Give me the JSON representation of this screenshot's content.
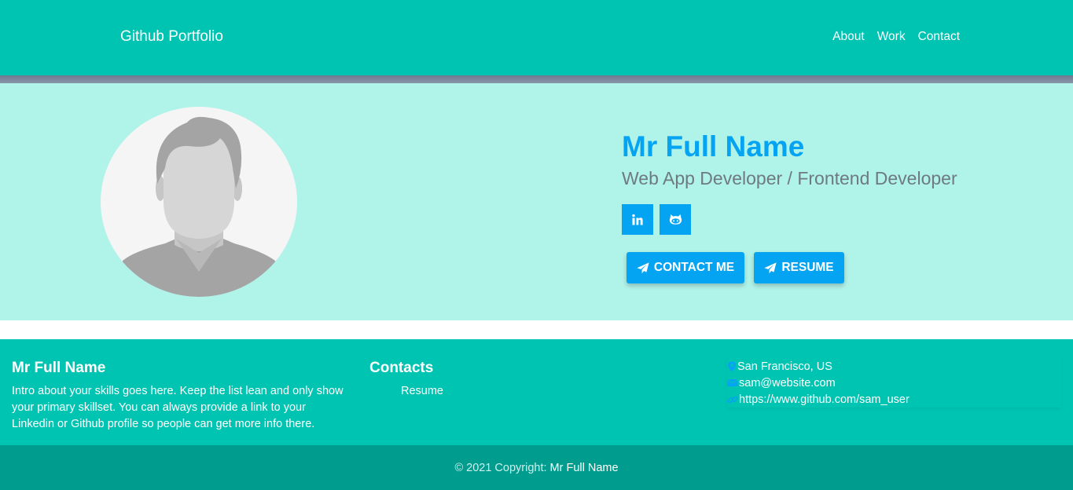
{
  "navbar": {
    "brand": "Github Portfolio",
    "links": [
      "About",
      "Work",
      "Contact"
    ]
  },
  "hero": {
    "name": "Mr Full Name",
    "role": "Web App Developer / Frontend Developer",
    "social_icons": [
      "linkedin-icon",
      "github-icon"
    ],
    "buttons": {
      "contact_label": "CONTACT ME",
      "resume_label": "RESUME",
      "icon": "paper-plane-icon"
    }
  },
  "footer": {
    "about_title": "Mr Full Name",
    "about_text": "Intro about your skills goes here. Keep the list lean and only show your primary skillset. You can always provide a link to your Linkedin or Github profile so people can get more info there.",
    "contacts_title": "Contacts",
    "contacts_links": [
      "Resume"
    ],
    "contact_items": [
      {
        "icon": "location-pin-icon",
        "text": "San Francisco, US"
      },
      {
        "icon": "envelope-icon",
        "text": "sam@website.com"
      },
      {
        "icon": "link-icon",
        "text": "https://www.github.com/sam_user"
      }
    ]
  },
  "copyright": {
    "prefix": "© 2021 Copyright:",
    "name": "Mr Full Name"
  },
  "colors": {
    "primary_teal": "#00c4b2",
    "hero_background": "#b0f3e9",
    "accent_blue": "#05a4f2",
    "copyright_background": "#009d8e",
    "subtitle_gray": "#6f7a80"
  }
}
